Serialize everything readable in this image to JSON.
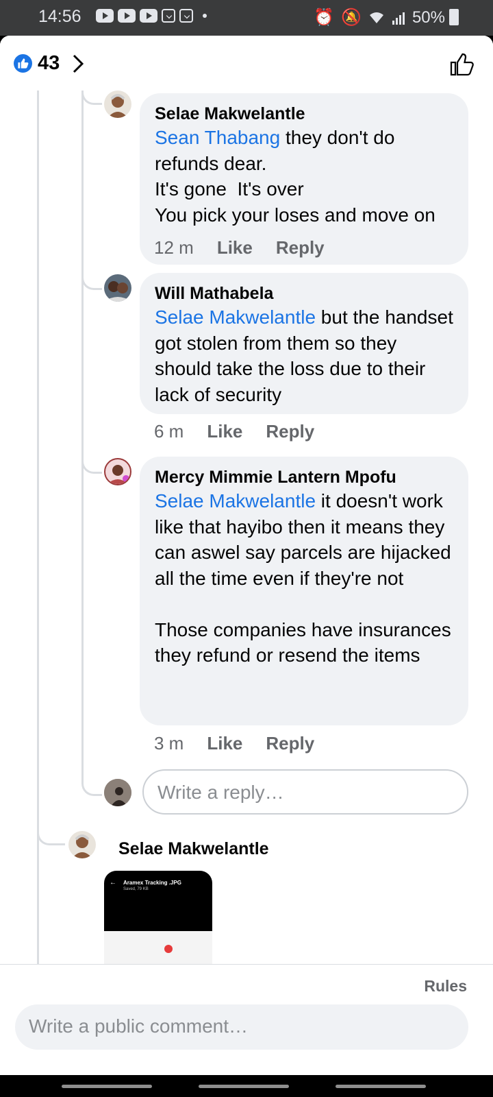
{
  "status_bar": {
    "time": "14:56",
    "battery": "50%"
  },
  "header": {
    "reaction_count": "43"
  },
  "comments": [
    {
      "author": "Selae Makwelantle",
      "mention": "Sean Thabang",
      "text": " they don't do refunds dear.\nIt's gone  It's over\nYou pick your loses and move on",
      "time": "12 m",
      "like": "Like",
      "reply": "Reply"
    },
    {
      "author": "Will Mathabela",
      "mention": "Selae Makwelantle",
      "text": " but the handset got stolen from them so they should take the loss due to their lack of security",
      "time": "6 m",
      "like": "Like",
      "reply": "Reply"
    },
    {
      "author": "Mercy Mimmie Lantern Mpofu",
      "mention": "Selae Makwelantle",
      "text": " it doesn't work like that hayibo then it means they can aswel say parcels are hijacked all the time even if they're not\n\nThose companies have insurances they refund or resend the items",
      "time": "3 m",
      "like": "Like",
      "reply": "Reply"
    }
  ],
  "reply_placeholder": "Write a reply…",
  "next_comment": {
    "author": "Selae Makwelantle",
    "attachment": {
      "title": "Aramex Tracking .JPG",
      "subtitle": "Saved, 79 KB"
    }
  },
  "footer": {
    "rules": "Rules",
    "comment_placeholder": "Write a public comment…"
  },
  "colors": {
    "accent": "#1b74e4",
    "bubble": "#f0f2f5",
    "muted": "#65676b"
  }
}
